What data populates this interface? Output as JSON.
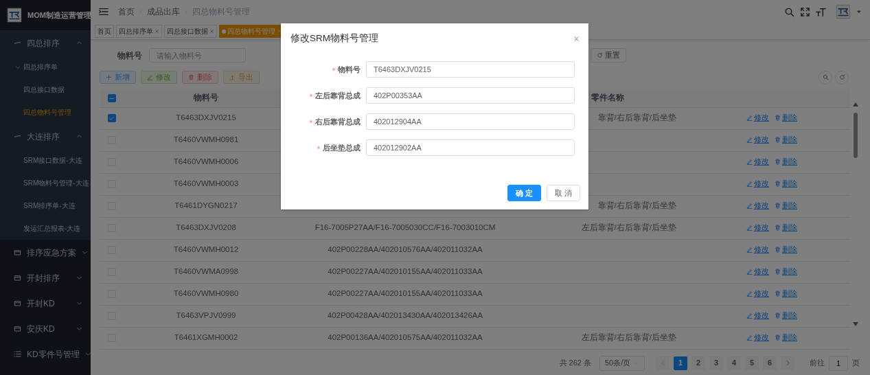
{
  "sidebar": {
    "title": "MOM制造运营管理",
    "items": [
      {
        "label": "四总排序",
        "expanded": true,
        "children": [
          {
            "label": "四总排序单",
            "expanded": true,
            "children": [
              {
                "label": "四总接口数据",
                "selected": false
              },
              {
                "label": "四总物料号管理",
                "selected": true
              }
            ]
          }
        ]
      },
      {
        "label": "大连排序",
        "expanded": true,
        "children": [
          {
            "label": "SRM接口数据-大连",
            "selected": false
          },
          {
            "label": "SRM物料号管理-大连",
            "selected": false
          },
          {
            "label": "SRM排序单-大连",
            "selected": false
          },
          {
            "label": "发运汇总报表-大连",
            "selected": false
          }
        ]
      },
      {
        "label": "排序应急方案",
        "expanded": false
      },
      {
        "label": "开封排序",
        "expanded": false
      },
      {
        "label": "开封KD",
        "expanded": false
      },
      {
        "label": "安庆KD",
        "expanded": false
      },
      {
        "label": "KD零件号管理",
        "expanded": false
      }
    ]
  },
  "breadcrumb": [
    "首页",
    "成品出库",
    "四总物料号管理"
  ],
  "tabs": [
    {
      "label": "首页",
      "selected": false,
      "closable": false
    },
    {
      "label": "四总排序单",
      "selected": false,
      "closable": true
    },
    {
      "label": "四总接口数据",
      "selected": false,
      "closable": true
    },
    {
      "label": "四总物料号管理",
      "selected": true,
      "closable": true
    }
  ],
  "search_form": {
    "label": "物料号",
    "placeholder": "请输入物料号",
    "reset_button": "重置"
  },
  "toolbar": [
    {
      "label": "新增",
      "kind": "add"
    },
    {
      "label": "修改",
      "kind": "edit"
    },
    {
      "label": "删除",
      "kind": "delete"
    },
    {
      "label": "导出",
      "kind": "export"
    }
  ],
  "table": {
    "header_checked": true,
    "header_indeterminate": true,
    "part_no_header": "物料号",
    "part_name_header": "零件名称",
    "rows": [
      {
        "selected": true,
        "part_no": "T6463DXJV0215",
        "part_name": "靠背/右后靠背/后坐垫",
        "actions": [
          "修改",
          "删除"
        ]
      },
      {
        "selected": false,
        "part_no": "T6460VWMH0981",
        "actions": [
          "修改",
          "删除"
        ]
      },
      {
        "selected": false,
        "part_no": "T6460VWMH0006",
        "actions": [
          "修改",
          "删除"
        ]
      },
      {
        "selected": false,
        "part_no": "T6460VWMH0003",
        "actions": [
          "修改",
          "删除"
        ]
      },
      {
        "selected": false,
        "part_no": "T6461DYGN0217",
        "part_name": "靠背/右后靠背/后坐垫",
        "actions": [
          "修改",
          "删除"
        ]
      },
      {
        "selected": false,
        "part_no": "T6463DXJV0208",
        "column_2": "F16-7005P27AA/F16-7005030CC/F16-7003010CM",
        "part_name": "左后靠背/右后靠背/后坐垫",
        "actions": [
          "修改",
          "删除"
        ]
      },
      {
        "selected": false,
        "part_no": "T6460VWMH0012",
        "column_2": "402P00228AA/402010576AA/402011032AA",
        "actions": [
          "修改",
          "删除"
        ]
      },
      {
        "selected": false,
        "part_no": "T6460VWMA0998",
        "column_2": "402P00227AA/402010155AA/402011033AA",
        "actions": [
          "修改",
          "删除"
        ]
      },
      {
        "selected": false,
        "part_no": "T6460VWMH0980",
        "column_2": "402P00227AA/402010155AA/402011033AA",
        "actions": [
          "修改",
          "删除"
        ]
      },
      {
        "selected": false,
        "part_no": "T6463VPJV0999",
        "column_2": "402P00428AA/402013430AA/402013426AA",
        "actions": [
          "修改",
          "删除"
        ]
      },
      {
        "selected": false,
        "part_no": "T6461XGMH0002",
        "column_2": "402P00136AA/402010575AA/402011032AA",
        "part_name": "左后靠背/右后靠背/后坐垫",
        "actions": [
          "修改",
          "删除"
        ]
      }
    ]
  },
  "pagination": {
    "total": "共 262 条",
    "page_size": "50条/页",
    "pages": [
      {
        "label": "1",
        "selected": true
      },
      {
        "label": "2",
        "selected": false
      },
      {
        "label": "3",
        "selected": false
      },
      {
        "label": "4",
        "selected": false
      },
      {
        "label": "5",
        "selected": false
      },
      {
        "label": "6",
        "selected": false
      }
    ],
    "goto_label": "前往",
    "goto_value": "1",
    "goto_suffix": "页"
  },
  "modal": {
    "title": "修改SRM物料号管理",
    "fields": [
      {
        "label": "物料号",
        "required": true,
        "value": "T6463DXJV0215"
      },
      {
        "label": "左后靠背总成",
        "required": true,
        "value": "402P00353AA"
      },
      {
        "label": "右后靠背总成",
        "required": true,
        "value": "402012904AA"
      },
      {
        "label": "后坐垫总成",
        "required": true,
        "value": "402012902AA"
      }
    ],
    "buttons": [
      {
        "label": "确 定",
        "kind": "primary"
      },
      {
        "label": "取 消",
        "kind": "default"
      }
    ]
  }
}
